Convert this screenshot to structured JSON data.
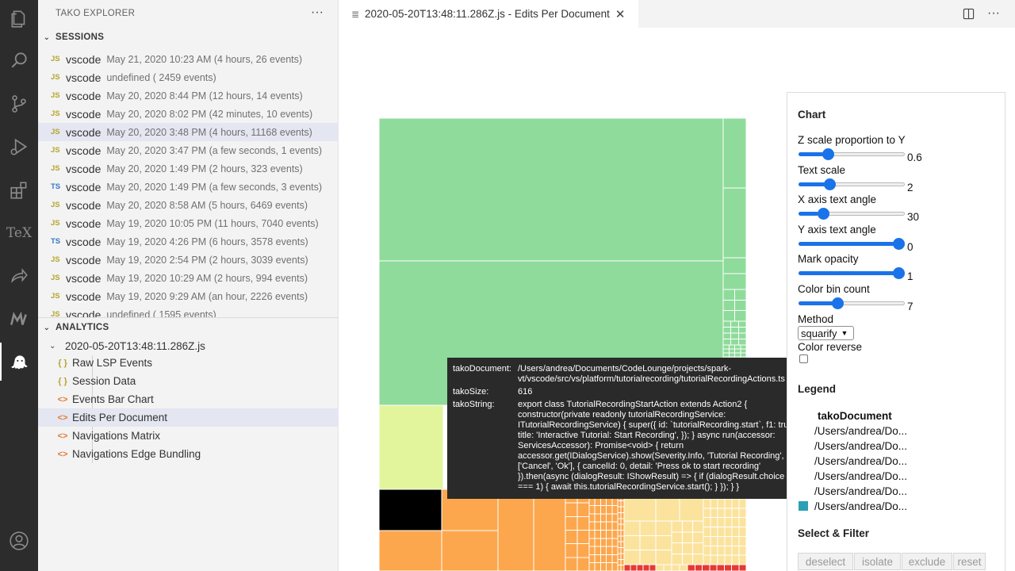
{
  "sidebar": {
    "title": "TAKO EXPLORER",
    "sessions_header": "SESSIONS",
    "sessions": [
      {
        "lang": "JS",
        "name": "vscode",
        "desc": "May 21, 2020 10:23 AM (4 hours,  26 events)"
      },
      {
        "lang": "JS",
        "name": "vscode",
        "desc": "undefined ( 2459 events)"
      },
      {
        "lang": "JS",
        "name": "vscode",
        "desc": "May 20, 2020 8:44 PM (12 hours,  14 events)"
      },
      {
        "lang": "JS",
        "name": "vscode",
        "desc": "May 20, 2020 8:02 PM (42 minutes,  10 events)"
      },
      {
        "lang": "JS",
        "name": "vscode",
        "desc": "May 20, 2020 3:48 PM (4 hours,  11168 events)"
      },
      {
        "lang": "JS",
        "name": "vscode",
        "desc": "May 20, 2020 3:47 PM (a few seconds,  1 events)"
      },
      {
        "lang": "JS",
        "name": "vscode",
        "desc": "May 20, 2020 1:49 PM (2 hours,  323 events)"
      },
      {
        "lang": "TS",
        "name": "vscode",
        "desc": "May 20, 2020 1:49 PM (a few seconds,  3 events)"
      },
      {
        "lang": "JS",
        "name": "vscode",
        "desc": "May 20, 2020 8:58 AM (5 hours,  6469 events)"
      },
      {
        "lang": "JS",
        "name": "vscode",
        "desc": "May 19, 2020 10:05 PM (11 hours,  7040 events)"
      },
      {
        "lang": "TS",
        "name": "vscode",
        "desc": "May 19, 2020 4:26 PM (6 hours,  3578 events)"
      },
      {
        "lang": "JS",
        "name": "vscode",
        "desc": "May 19, 2020 2:54 PM (2 hours,  3039 events)"
      },
      {
        "lang": "JS",
        "name": "vscode",
        "desc": "May 19, 2020 10:29 AM (2 hours,  994 events)"
      },
      {
        "lang": "JS",
        "name": "vscode",
        "desc": "May 19, 2020 9:29 AM (an hour,  2226 events)"
      },
      {
        "lang": "JS",
        "name": "vscode",
        "desc": "undefined ( 1595 events)"
      }
    ],
    "analytics_header": "ANALYTICS",
    "analytics_file": "2020-05-20T13:48:11.286Z.js",
    "views": [
      {
        "icon": "{ }",
        "label": "Raw LSP Events"
      },
      {
        "icon": "{ }",
        "label": "Session Data"
      },
      {
        "icon": "<>",
        "label": "Events Bar Chart"
      },
      {
        "icon": "<>",
        "label": "Edits Per Document"
      },
      {
        "icon": "<>",
        "label": "Navigations Matrix"
      },
      {
        "icon": "<>",
        "label": "Navigations Edge Bundling"
      }
    ]
  },
  "tab": {
    "label": "2020-05-20T13:48:11.286Z.js - Edits Per Document"
  },
  "tooltip": {
    "doc_key": "takoDocument:",
    "doc_val": "/Users/andrea/Documents/CodeLounge/projects/spark-vt/vscode/src/vs/platform/tutorialrecording/tutorialRecordingActions.ts",
    "size_key": "takoSize:",
    "size_val": "616",
    "string_key": "takoString:",
    "string_val": "export class TutorialRecordingStartAction extends Action2 { constructor(private readonly tutorialRecordingService: ITutorialRecordingService) { super({ id: `tutorialRecording.start`, f1: true, title: 'Interactive Tutorial: Start Recording', }); } async run(accessor: ServicesAccessor): Promise<void> { return accessor.get(IDialogService).show(Severity.Info, 'Tutorial Recording', ['Cancel', 'Ok'], { cancelId: 0, detail: 'Press ok to start recording' }).then(async (dialogResult: IShowResult) => { if (dialogResult.choice === 1) { await this.tutorialRecordingService.start(); } }); } }"
  },
  "panel": {
    "chart_header": "Chart",
    "controls": [
      {
        "label": "Z scale proportion to Y",
        "value": "0.6",
        "fraction": 0.25
      },
      {
        "label": "Text scale",
        "value": "2",
        "fraction": 0.27
      },
      {
        "label": "X axis text angle",
        "value": "30",
        "fraction": 0.2
      },
      {
        "label": "Y axis text angle",
        "value": "0",
        "fraction": 1.0
      },
      {
        "label": "Mark opacity",
        "value": "1",
        "fraction": 1.0
      },
      {
        "label": "Color bin count",
        "value": "7",
        "fraction": 0.35
      }
    ],
    "method_label": "Method",
    "method_value": "squarify",
    "color_reverse_label": "Color reverse",
    "legend_header": "Legend",
    "legend_title": "takoDocument",
    "legend_items": [
      {
        "label": "/Users/andrea/Do...",
        "color": "#ffffff"
      },
      {
        "label": "/Users/andrea/Do...",
        "color": "#ffffff"
      },
      {
        "label": "/Users/andrea/Do...",
        "color": "#ffffff"
      },
      {
        "label": "/Users/andrea/Do...",
        "color": "#ffffff"
      },
      {
        "label": "/Users/andrea/Do...",
        "color": "#ffffff"
      },
      {
        "label": "/Users/andrea/Do...",
        "color": "#2aa0b7"
      }
    ],
    "select_header": "Select & Filter",
    "buttons": [
      "deselect",
      "isolate",
      "exclude",
      "reset"
    ]
  },
  "treemap_colors": {
    "green": "#8fdb9b",
    "yellow": "#e2f59c",
    "orange": "#fca74d",
    "cream": "#fbe39d",
    "black": "#000000",
    "red": "#e53935"
  }
}
